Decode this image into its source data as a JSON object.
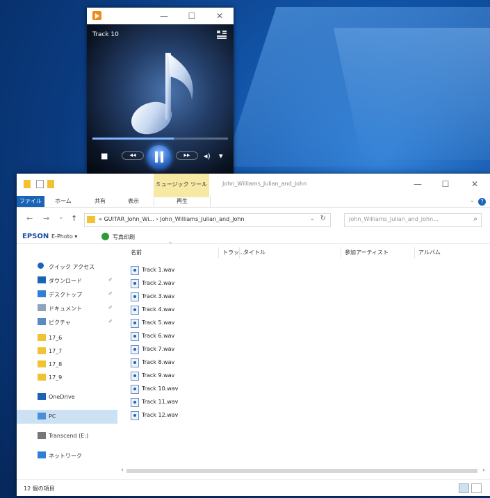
{
  "player": {
    "track_title": "Track 10",
    "minimize": "—",
    "maximize": "☐",
    "close": "✕",
    "progress_fraction": 0.6,
    "controls": {
      "stop": "■",
      "prev": "◂◂",
      "next": "▸▸",
      "volume": "◂)",
      "volume_arrow": "▾"
    }
  },
  "explorer": {
    "title_path": "John_Williams_Julian_and_John",
    "context_tab": "ミュージック ツール",
    "minimize": "—",
    "maximize": "☐",
    "close": "✕",
    "ribbon_tabs": {
      "file": "ファイル",
      "home": "ホーム",
      "share": "共有",
      "view": "表示",
      "play": "再生"
    },
    "ribbon_chevron": "⌄",
    "help": "?",
    "nav_buttons": {
      "back": "←",
      "forward": "→",
      "down": "⌄",
      "up": "↑"
    },
    "address_text": "« GUITAR_John_Wi... › John_Williams_Julian_and_John",
    "address_dropdown": "⌄",
    "refresh": "↻",
    "search_placeholder": "John_Williams_Julian_and_John... ",
    "search_icon": "⌕",
    "epson": {
      "logo": "EPSON",
      "product": "E-Photo ▾",
      "print_label": "写真印刷"
    },
    "nav_pane": [
      {
        "label": "クイック アクセス",
        "icon": "star-icon",
        "pinned": false
      },
      {
        "label": "ダウンロード",
        "icon": "download-icon",
        "pinned": true
      },
      {
        "label": "デスクトップ",
        "icon": "desktop-icon",
        "pinned": true
      },
      {
        "label": "ドキュメント",
        "icon": "document-icon",
        "pinned": true
      },
      {
        "label": "ピクチャ",
        "icon": "pictures-icon",
        "pinned": true
      },
      {
        "label": "17_6",
        "icon": "folder-icon",
        "pinned": false
      },
      {
        "label": "17_7",
        "icon": "folder-icon",
        "pinned": false
      },
      {
        "label": "17_8",
        "icon": "folder-icon",
        "pinned": false
      },
      {
        "label": "17_9",
        "icon": "folder-icon",
        "pinned": false
      },
      {
        "label": "OneDrive",
        "icon": "cloud-icon",
        "pinned": false
      },
      {
        "label": "PC",
        "icon": "pc-icon",
        "pinned": false,
        "selected": true
      },
      {
        "label": "Transcend (E:)",
        "icon": "drive-icon",
        "pinned": false
      },
      {
        "label": "ネットワーク",
        "icon": "network-icon",
        "pinned": false
      }
    ],
    "pin_glyph": "✐",
    "columns": [
      "名前",
      "トラッ...",
      "タイトル",
      "参加アーティスト",
      "アルバム"
    ],
    "sort_arrow": "^",
    "files": [
      "Track 1.wav",
      "Track 2.wav",
      "Track 3.wav",
      "Track 4.wav",
      "Track 5.wav",
      "Track 6.wav",
      "Track 7.wav",
      "Track 8.wav",
      "Track 9.wav",
      "Track 10.wav",
      "Track 11.wav",
      "Track 12.wav"
    ],
    "scroll_left": "‹",
    "scroll_right": "›",
    "status_text": "12 個の項目"
  },
  "colors": {
    "accent": "#1a64b8",
    "context_tab": "#f6e9a4",
    "folder": "#f1c232",
    "selection": "#cde1f5"
  }
}
